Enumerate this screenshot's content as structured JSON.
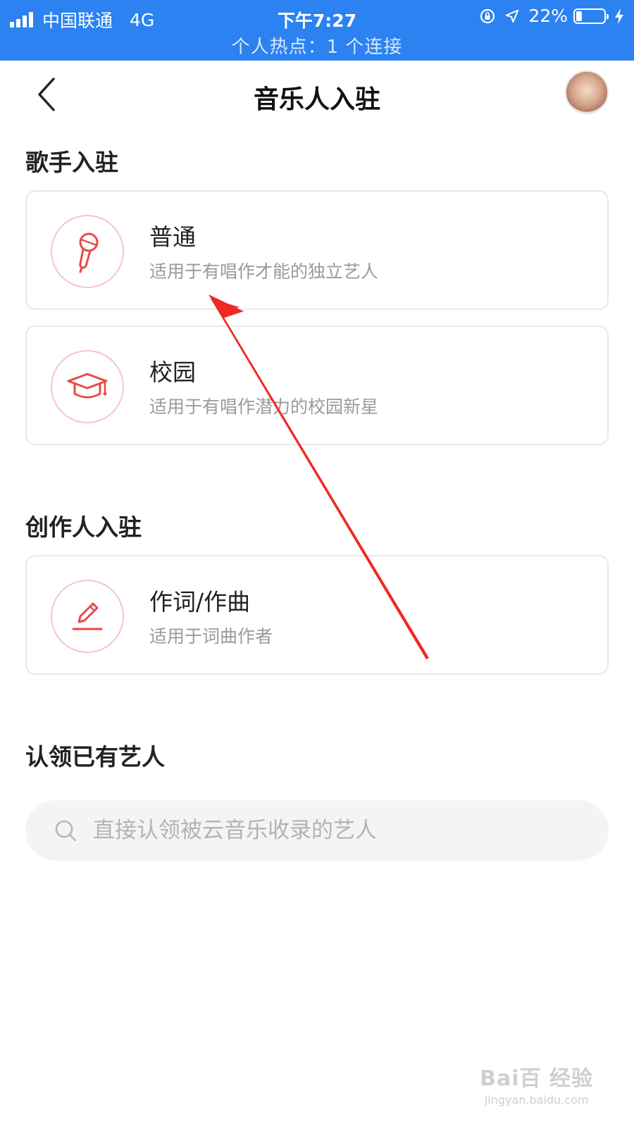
{
  "status_bar": {
    "carrier": "中国联通",
    "network": "4G",
    "time": "下午7:27",
    "battery": "22%",
    "battery_level": 0.22,
    "hotspot": "个人热点：1 个连接"
  },
  "nav": {
    "title": "音乐人入驻",
    "back_icon": "chevron-left-icon",
    "avatar": "user-avatar"
  },
  "singer_section": {
    "title": "歌手入驻",
    "cards": [
      {
        "title": "普通",
        "desc": "适用于有唱作才能的独立艺人",
        "icon": "microphone-icon"
      },
      {
        "title": "校园",
        "desc": "适用于有唱作潜力的校园新星",
        "icon": "graduation-cap-icon"
      }
    ]
  },
  "creator_section": {
    "title": "创作人入驻",
    "cards": [
      {
        "title": "作词/作曲",
        "desc": "适用于词曲作者",
        "icon": "pencil-icon"
      }
    ]
  },
  "claim_section": {
    "title": "认领已有艺人",
    "search_placeholder": "直接认领被云音乐收录的艺人",
    "search_value": ""
  },
  "watermark": {
    "brand": "Bai百 经验",
    "url": "jingyan.baidu.com"
  },
  "colors": {
    "status_bar": "#2b82f0",
    "accent": "#e84a4a",
    "icon_ring": "#f4c6c6",
    "annotation_arrow": "#ee2a22"
  }
}
